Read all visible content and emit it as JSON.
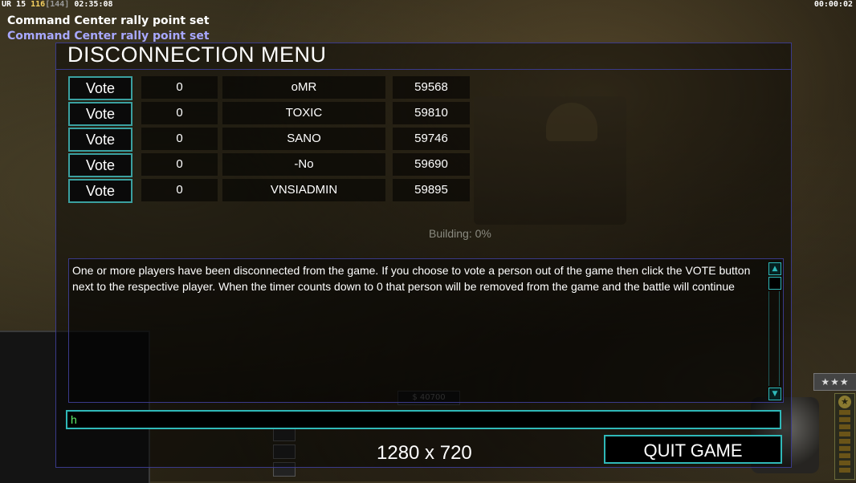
{
  "hud": {
    "rank_prefix": "UR 15",
    "money": "116",
    "bracket": "[144]",
    "clock": "02:35:08",
    "timer": "00:00:02"
  },
  "messages": [
    "Command Center rally point set",
    "Command Center rally point set"
  ],
  "dialog": {
    "title": "DISCONNECTION MENU",
    "vote_label": "Vote",
    "players": [
      {
        "votes": "0",
        "name": "oMR",
        "ping": "59568"
      },
      {
        "votes": "0",
        "name": "TOXIC",
        "ping": "59810"
      },
      {
        "votes": "0",
        "name": "SANO",
        "ping": "59746"
      },
      {
        "votes": "0",
        "name": "-No",
        "ping": "59690"
      },
      {
        "votes": "0",
        "name": "VNSIADMIN",
        "ping": "59895"
      }
    ],
    "status": "Building: 0%",
    "message": "One or more players have been disconnected from the game. If you choose to vote a person out of the game then click the VOTE button next to the respective player. When the timer counts down to 0 that person will be removed from the game and the battle will continue",
    "chat_value": "h",
    "quit_label": "QUIT GAME"
  },
  "overlay": {
    "resolution": "1280 x 720"
  },
  "background": {
    "money_display": "$ 40700",
    "rank_stars": "★★★"
  },
  "colors": {
    "accent": "#2fb8b8",
    "frame": "#3a3a8a",
    "chat_text": "#5ef06a",
    "money": "#f5d060",
    "message_alt": "#a8a8ff"
  }
}
